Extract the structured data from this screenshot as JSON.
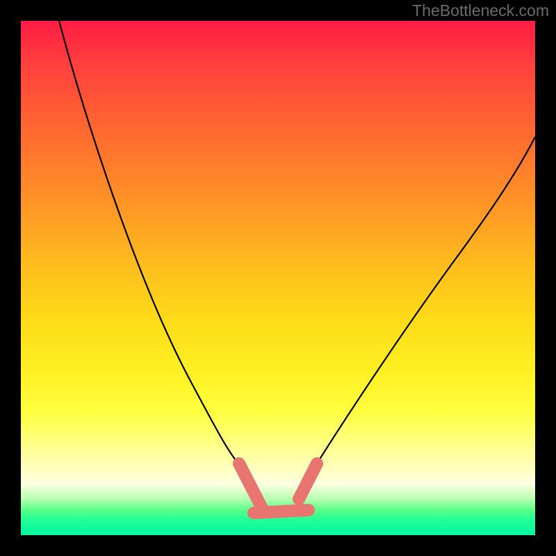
{
  "watermark": "TheBottleneck.com",
  "chart_data": {
    "type": "line",
    "title": "",
    "xlabel": "",
    "ylabel": "",
    "note": "No axis ticks, labels, or legend are visible. Values below are normalized to the plot-area square where (0,0) is top-left and (1,1) is bottom-right.",
    "curves": {
      "left_black": {
        "description": "Thin black curve descending from top-left, curving rightward to meet the pink segment near the bottom.",
        "points_xy_norm": [
          [
            0.075,
            0.0
          ],
          [
            0.118,
            0.128
          ],
          [
            0.16,
            0.254
          ],
          [
            0.205,
            0.379
          ],
          [
            0.252,
            0.502
          ],
          [
            0.296,
            0.605
          ],
          [
            0.34,
            0.701
          ],
          [
            0.381,
            0.781
          ],
          [
            0.412,
            0.838
          ],
          [
            0.432,
            0.872
          ]
        ]
      },
      "right_black": {
        "description": "Thin black curve rising from the right pink segment toward the upper-right edge.",
        "points_xy_norm": [
          [
            0.562,
            0.882
          ],
          [
            0.59,
            0.838
          ],
          [
            0.635,
            0.765
          ],
          [
            0.69,
            0.676
          ],
          [
            0.75,
            0.581
          ],
          [
            0.812,
            0.487
          ],
          [
            0.87,
            0.401
          ],
          [
            0.93,
            0.317
          ],
          [
            1.0,
            0.225
          ]
        ]
      },
      "pink_left": {
        "description": "Short thick pink segment near bottom, left side of valley.",
        "points_xy_norm": [
          [
            0.425,
            0.861
          ],
          [
            0.468,
            0.944
          ]
        ]
      },
      "pink_bottom": {
        "description": "Thick pink near-horizontal segment along the valley bottom.",
        "points_xy_norm": [
          [
            0.452,
            0.956
          ],
          [
            0.56,
            0.951
          ]
        ]
      },
      "pink_right": {
        "description": "Short thick pink segment near bottom, right side of valley.",
        "points_xy_norm": [
          [
            0.541,
            0.929
          ],
          [
            0.575,
            0.861
          ]
        ]
      }
    },
    "colors": {
      "gradient_top": "#ff1c45",
      "gradient_mid": "#fff023",
      "gradient_bottom": "#00f7a0",
      "curve_black": "#000000",
      "segment_pink": "#e8756f"
    }
  }
}
